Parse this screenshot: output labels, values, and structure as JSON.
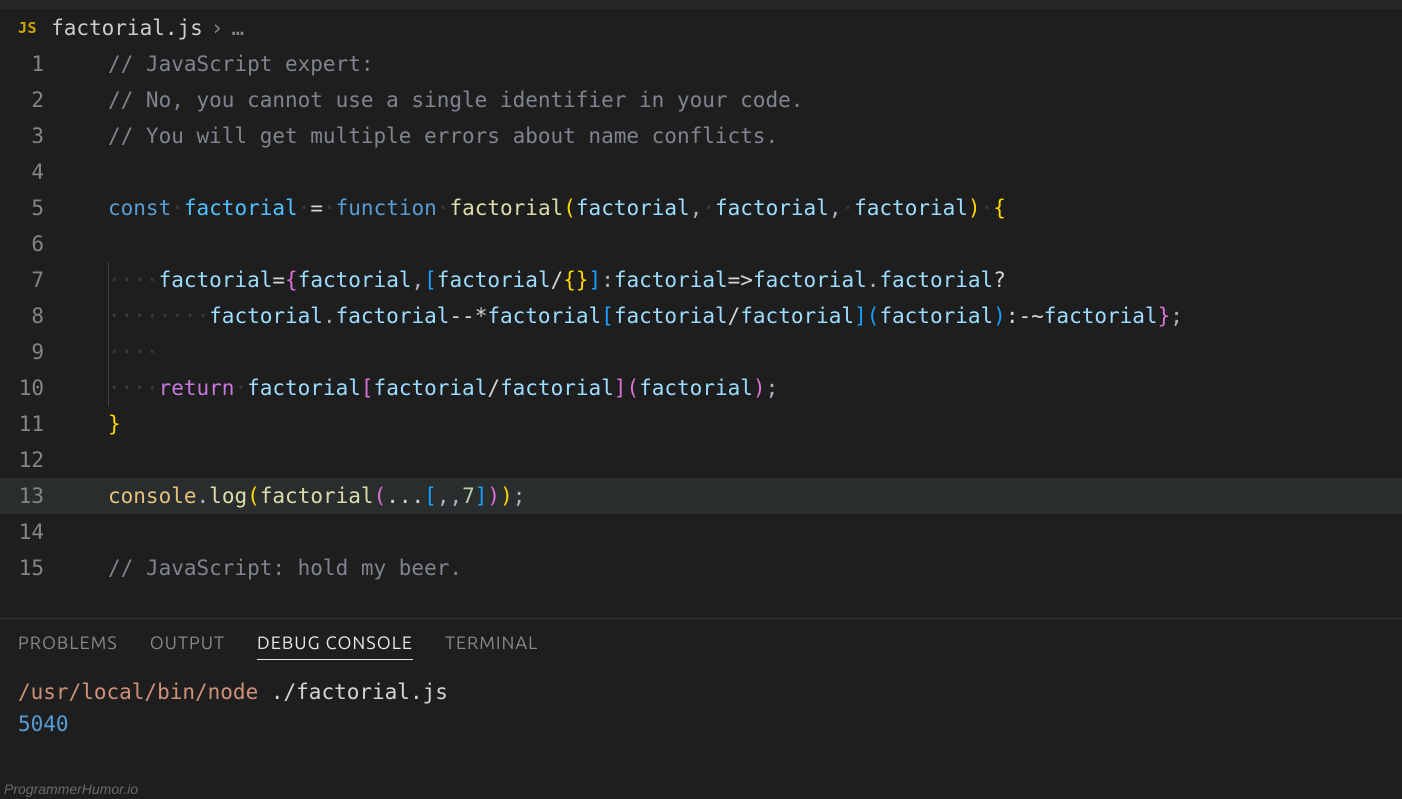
{
  "breadcrumb": {
    "js_badge": "JS",
    "filename": "factorial.js",
    "rest": "…"
  },
  "code": {
    "current_line": 13,
    "lines": [
      {
        "n": 1,
        "tokens": [
          [
            "tok-comment",
            "// JavaScript expert:"
          ]
        ]
      },
      {
        "n": 2,
        "tokens": [
          [
            "tok-comment",
            "// No, you cannot use a single identifier in your code."
          ]
        ]
      },
      {
        "n": 3,
        "tokens": [
          [
            "tok-comment",
            "// You will get multiple errors about name conflicts."
          ]
        ]
      },
      {
        "n": 4,
        "tokens": []
      },
      {
        "n": 5,
        "tokens": [
          [
            "tok-keyword",
            "const"
          ],
          [
            "ws",
            " "
          ],
          [
            "tok-const",
            "factorial"
          ],
          [
            "ws",
            " "
          ],
          [
            "tok-op",
            "="
          ],
          [
            "ws",
            " "
          ],
          [
            "tok-keyword",
            "function"
          ],
          [
            "ws",
            " "
          ],
          [
            "tok-func",
            "factorial"
          ],
          [
            "tok-brace-y",
            "("
          ],
          [
            "tok-var",
            "factorial"
          ],
          [
            "tok-punc",
            ","
          ],
          [
            "ws",
            " "
          ],
          [
            "tok-var",
            "factorial"
          ],
          [
            "tok-punc",
            ","
          ],
          [
            "ws",
            " "
          ],
          [
            "tok-var",
            "factorial"
          ],
          [
            "tok-brace-y",
            ")"
          ],
          [
            "ws",
            " "
          ],
          [
            "tok-brace-y",
            "{"
          ]
        ]
      },
      {
        "n": 6,
        "guide": true,
        "tokens": []
      },
      {
        "n": 7,
        "guide": true,
        "indent": 4,
        "tokens": [
          [
            "tok-var",
            "factorial"
          ],
          [
            "tok-op",
            "="
          ],
          [
            "tok-brace-p",
            "{"
          ],
          [
            "tok-var",
            "factorial"
          ],
          [
            "tok-punc",
            ","
          ],
          [
            "tok-brace-b",
            "["
          ],
          [
            "tok-var",
            "factorial"
          ],
          [
            "tok-op",
            "/"
          ],
          [
            "tok-brace-y",
            "{}"
          ],
          [
            "tok-brace-b",
            "]"
          ],
          [
            "tok-punc",
            ":"
          ],
          [
            "tok-var",
            "factorial"
          ],
          [
            "tok-op",
            "=>"
          ],
          [
            "tok-var",
            "factorial"
          ],
          [
            "tok-punc",
            "."
          ],
          [
            "tok-var",
            "factorial"
          ],
          [
            "tok-op",
            "?"
          ]
        ]
      },
      {
        "n": 8,
        "guide": true,
        "indent": 8,
        "tokens": [
          [
            "tok-var",
            "factorial"
          ],
          [
            "tok-punc",
            "."
          ],
          [
            "tok-var",
            "factorial"
          ],
          [
            "tok-op",
            "--"
          ],
          [
            "tok-op",
            "*"
          ],
          [
            "tok-var",
            "factorial"
          ],
          [
            "tok-brace-b",
            "["
          ],
          [
            "tok-var",
            "factorial"
          ],
          [
            "tok-op",
            "/"
          ],
          [
            "tok-var",
            "factorial"
          ],
          [
            "tok-brace-b",
            "]"
          ],
          [
            "tok-brace-b",
            "("
          ],
          [
            "tok-var",
            "factorial"
          ],
          [
            "tok-brace-b",
            ")"
          ],
          [
            "tok-op",
            ":"
          ],
          [
            "tok-op",
            "-~"
          ],
          [
            "tok-var",
            "factorial"
          ],
          [
            "tok-brace-p",
            "}"
          ],
          [
            "tok-punc",
            ";"
          ]
        ]
      },
      {
        "n": 9,
        "guide": true,
        "indent": 4,
        "tokens": []
      },
      {
        "n": 10,
        "guide": true,
        "indent": 4,
        "tokens": [
          [
            "tok-storage",
            "return"
          ],
          [
            "ws",
            " "
          ],
          [
            "tok-var",
            "factorial"
          ],
          [
            "tok-brace-p",
            "["
          ],
          [
            "tok-var",
            "factorial"
          ],
          [
            "tok-op",
            "/"
          ],
          [
            "tok-var",
            "factorial"
          ],
          [
            "tok-brace-p",
            "]"
          ],
          [
            "tok-brace-p",
            "("
          ],
          [
            "tok-var",
            "factorial"
          ],
          [
            "tok-brace-p",
            ")"
          ],
          [
            "tok-punc",
            ";"
          ]
        ]
      },
      {
        "n": 11,
        "tokens": [
          [
            "tok-brace-y",
            "}"
          ]
        ]
      },
      {
        "n": 12,
        "tokens": []
      },
      {
        "n": 13,
        "tokens": [
          [
            "tok-ident",
            "console"
          ],
          [
            "tok-punc",
            "."
          ],
          [
            "tok-func",
            "log"
          ],
          [
            "tok-brace-y",
            "("
          ],
          [
            "tok-func",
            "factorial"
          ],
          [
            "tok-brace-p",
            "("
          ],
          [
            "tok-op",
            "..."
          ],
          [
            "tok-brace-b",
            "["
          ],
          [
            "tok-punc",
            ",,"
          ],
          [
            "tok-num",
            "7"
          ],
          [
            "tok-brace-b",
            "]"
          ],
          [
            "tok-brace-p",
            ")"
          ],
          [
            "tok-brace-y",
            ")"
          ],
          [
            "tok-punc",
            ";"
          ]
        ]
      },
      {
        "n": 14,
        "tokens": []
      },
      {
        "n": 15,
        "tokens": [
          [
            "tok-comment",
            "// JavaScript: hold my beer."
          ]
        ]
      }
    ]
  },
  "panel": {
    "tabs": [
      {
        "id": "problems",
        "label": "PROBLEMS",
        "active": false
      },
      {
        "id": "output",
        "label": "OUTPUT",
        "active": false
      },
      {
        "id": "debug",
        "label": "DEBUG CONSOLE",
        "active": true
      },
      {
        "id": "terminal",
        "label": "TERMINAL",
        "active": false
      }
    ],
    "run_path": "/usr/local/bin/node ",
    "run_file": "./factorial.js",
    "output": "5040"
  },
  "watermark": "ProgrammerHumor.io"
}
